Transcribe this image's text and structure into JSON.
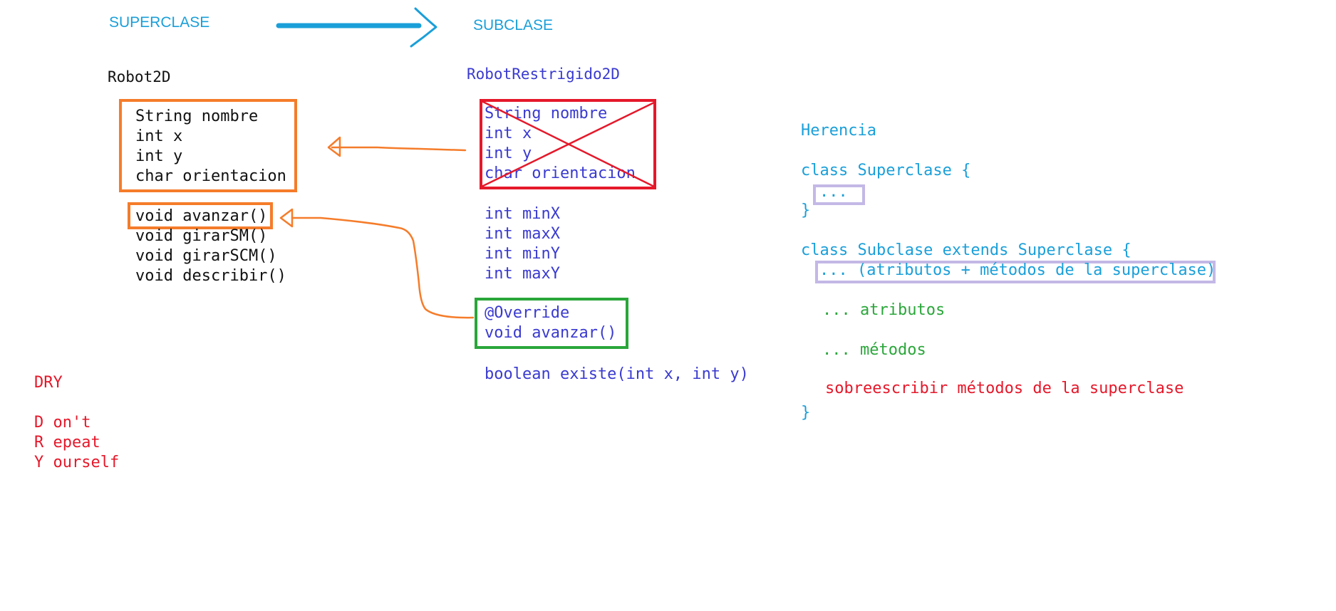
{
  "header": {
    "superclase": "SUPERCLASE",
    "subclase": "SUBCLASE"
  },
  "robot2d": {
    "name": "Robot2D",
    "attributes": [
      "String nombre",
      "int x",
      "int y",
      "char orientacion"
    ],
    "methods": [
      "void avanzar()",
      "void girarSM()",
      "void girarSCM()",
      "void describir()"
    ]
  },
  "robot_restringido": {
    "name": "RobotRestrigido2D",
    "inherited_attributes": [
      "String nombre",
      "int x",
      "int y",
      "char orientacion"
    ],
    "new_attributes": [
      "int minX",
      "int maxX",
      "int minY",
      "int maxY"
    ],
    "override_annotation": "@Override",
    "override_method": "void avanzar()",
    "new_method": "boolean existe(int x, int y)"
  },
  "dry": {
    "title": "DRY",
    "lines": [
      "D on't",
      "R epeat",
      "Y ourself"
    ]
  },
  "herencia": {
    "title": "Herencia",
    "superclass_open": "class Superclase {",
    "superclass_body": "...",
    "close1": "}",
    "subclass_open": "class Subclase extends Superclase {",
    "inherited": "... (atributos + métodos de la superclase)",
    "atributos": "... atributos",
    "metodos": "... métodos",
    "sobreescribir": "sobreescribir métodos de la superclase",
    "close2": "}"
  },
  "colors": {
    "cyan": "#1a9fd9",
    "blue": "#3a3ad0",
    "orange": "#f57c2a",
    "red": "#e5182a",
    "green": "#2aa63a",
    "lavender": "#c3b8e6"
  }
}
